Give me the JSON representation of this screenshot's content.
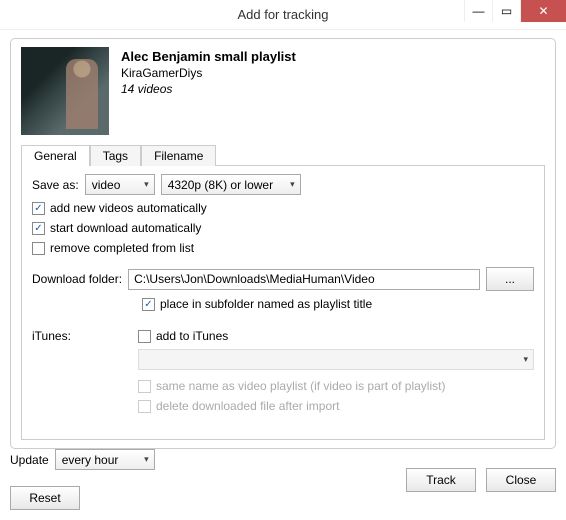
{
  "window": {
    "title": "Add for tracking",
    "minimize": "—",
    "maximize": "▭",
    "close": "✕"
  },
  "video": {
    "title": "Alec Benjamin small playlist",
    "author": "KiraGamerDiys",
    "count": "14 videos",
    "thumb_overlay": ""
  },
  "tabs": {
    "general": "General",
    "tags": "Tags",
    "filename": "Filename"
  },
  "general": {
    "save_as_label": "Save as:",
    "format": "video",
    "quality": "4320p (8K) or lower",
    "add_new": "add new videos automatically",
    "start_download": "start download automatically",
    "remove_completed": "remove completed from list",
    "download_folder_label": "Download folder:",
    "download_folder_value": "C:\\Users\\Jon\\Downloads\\MediaHuman\\Video",
    "browse": "...",
    "place_subfolder": "place in subfolder named as playlist title",
    "itunes_label": "iTunes:",
    "add_to_itunes": "add to iTunes",
    "same_name": "same name as video playlist (if video is part of playlist)",
    "delete_after": "delete downloaded file after import"
  },
  "footer": {
    "update_label": "Update",
    "update_value": "every hour",
    "reset": "Reset",
    "track": "Track",
    "close": "Close"
  },
  "checks": {
    "add_new": true,
    "start_download": true,
    "remove_completed": false,
    "place_subfolder": true,
    "add_to_itunes": false
  }
}
